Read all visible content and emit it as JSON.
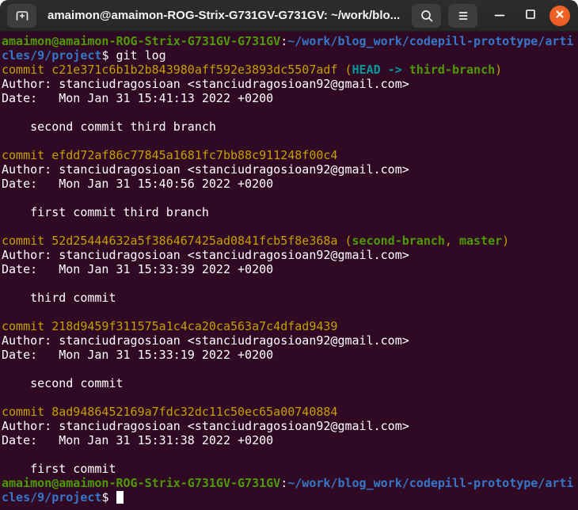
{
  "window": {
    "title": "amaimon@amaimon-ROG-Strix-G731GV-G731GV: ~/work/blo...",
    "icons": [
      "new-tab-icon",
      "search-icon",
      "menu-icon",
      "minimize-icon",
      "maximize-icon",
      "close-icon"
    ]
  },
  "colors": {
    "titlebar_bg": "#2a2a2a",
    "titlebar_button_bg": "#3d3d3d",
    "close_button": "#e9541f",
    "terminal_bg": "#300a24",
    "foreground": "#ffffff",
    "prompt_green": "#4e9a06",
    "path_blue": "#3677c9",
    "commit_yellow": "#c4a000",
    "head_cyan": "#06989a"
  },
  "terminal": {
    "command": "git log",
    "lines": [
      [
        {
          "c": "green",
          "t": "amaimon@amaimon-ROG-Strix-G731GV-G731GV"
        },
        {
          "c": "fg",
          "t": ":"
        },
        {
          "c": "blue",
          "t": "~/work/blog_work/codepill-prototype/arti"
        }
      ],
      [
        {
          "c": "blue",
          "t": "cles/9/project"
        },
        {
          "c": "fg",
          "t": "$ git log"
        }
      ],
      [
        {
          "c": "yellow",
          "t": "commit c21e371c6b1b2b843980aff592e3893dc5507adf ("
        },
        {
          "c": "cyan",
          "t": "HEAD -> "
        },
        {
          "c": "green",
          "t": "third-branch"
        },
        {
          "c": "yellow",
          "t": ")"
        }
      ],
      [
        {
          "c": "fg",
          "t": "Author: stanciudragosioan <stanciudragosioan92@gmail.com>"
        }
      ],
      [
        {
          "c": "fg",
          "t": "Date:   Mon Jan 31 15:41:13 2022 +0200"
        }
      ],
      [],
      [
        {
          "c": "fg",
          "t": "    second commit third branch"
        }
      ],
      [],
      [
        {
          "c": "yellow",
          "t": "commit efdd72af86c77845a1681fc7bb88c911248f00c4"
        }
      ],
      [
        {
          "c": "fg",
          "t": "Author: stanciudragosioan <stanciudragosioan92@gmail.com>"
        }
      ],
      [
        {
          "c": "fg",
          "t": "Date:   Mon Jan 31 15:40:56 2022 +0200"
        }
      ],
      [],
      [
        {
          "c": "fg",
          "t": "    first commit third branch"
        }
      ],
      [],
      [
        {
          "c": "yellow",
          "t": "commit 52d25444632a5f386467425ad0841fcb5f8e368a ("
        },
        {
          "c": "green",
          "t": "second-branch"
        },
        {
          "c": "yellow",
          "t": ", "
        },
        {
          "c": "green",
          "t": "master"
        },
        {
          "c": "yellow",
          "t": ")"
        }
      ],
      [
        {
          "c": "fg",
          "t": "Author: stanciudragosioan <stanciudragosioan92@gmail.com>"
        }
      ],
      [
        {
          "c": "fg",
          "t": "Date:   Mon Jan 31 15:33:39 2022 +0200"
        }
      ],
      [],
      [
        {
          "c": "fg",
          "t": "    third commit"
        }
      ],
      [],
      [
        {
          "c": "yellow",
          "t": "commit 218d9459f311575a1c4ca20ca563a7c4dfad9439"
        }
      ],
      [
        {
          "c": "fg",
          "t": "Author: stanciudragosioan <stanciudragosioan92@gmail.com>"
        }
      ],
      [
        {
          "c": "fg",
          "t": "Date:   Mon Jan 31 15:33:19 2022 +0200"
        }
      ],
      [],
      [
        {
          "c": "fg",
          "t": "    second commit"
        }
      ],
      [],
      [
        {
          "c": "yellow",
          "t": "commit 8ad9486452169a7fdc32dc11c50ec65a00740884"
        }
      ],
      [
        {
          "c": "fg",
          "t": "Author: stanciudragosioan <stanciudragosioan92@gmail.com>"
        }
      ],
      [
        {
          "c": "fg",
          "t": "Date:   Mon Jan 31 15:31:38 2022 +0200"
        }
      ],
      [],
      [
        {
          "c": "fg",
          "t": "    first commit"
        }
      ],
      [
        {
          "c": "green",
          "t": "amaimon@amaimon-ROG-Strix-G731GV-G731GV"
        },
        {
          "c": "fg",
          "t": ":"
        },
        {
          "c": "blue",
          "t": "~/work/blog_work/codepill-prototype/arti"
        }
      ],
      [
        {
          "c": "blue",
          "t": "cles/9/project"
        },
        {
          "c": "fg",
          "t": "$ "
        },
        {
          "c": "cursor",
          "t": ""
        }
      ]
    ]
  }
}
